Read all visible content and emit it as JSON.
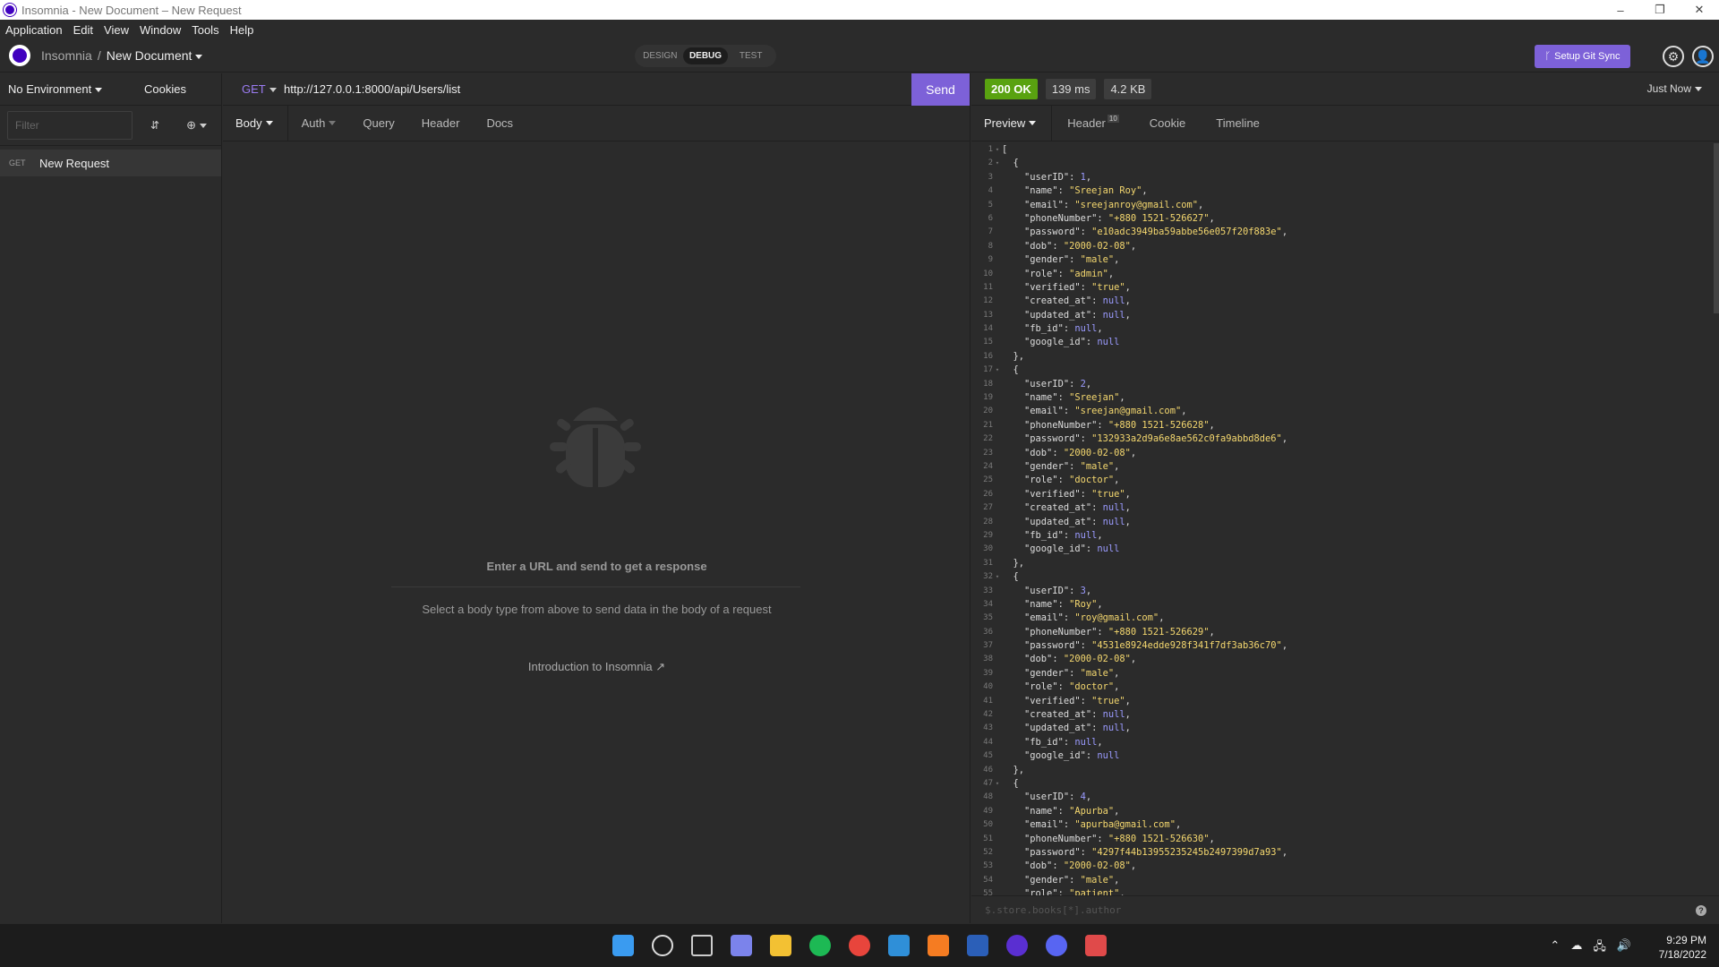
{
  "window": {
    "title": "Insomnia - New Document – New Request",
    "controls": [
      "–",
      "❐",
      "✕"
    ]
  },
  "menu": [
    "Application",
    "Edit",
    "View",
    "Window",
    "Tools",
    "Help"
  ],
  "header": {
    "app_name": "Insomnia",
    "separator": "/",
    "document": "New Document",
    "modes": [
      "DESIGN",
      "DEBUG",
      "TEST"
    ],
    "active_mode": "DEBUG",
    "git_sync_label": "Setup Git Sync"
  },
  "sidebar": {
    "environment": "No Environment",
    "cookies": "Cookies",
    "filter_placeholder": "Filter",
    "requests": [
      {
        "method": "GET",
        "name": "New Request"
      }
    ]
  },
  "request": {
    "method": "GET",
    "url": "http://127.0.0.1:8000/api/Users/list",
    "send_label": "Send",
    "tabs": [
      "Body",
      "Auth",
      "Query",
      "Header",
      "Docs"
    ],
    "empty_title": "Enter a URL and send to get a response",
    "empty_subtitle": "Select a body type from above to send data in the body of a request",
    "intro_link": "Introduction to Insomnia"
  },
  "response": {
    "status": "200 OK",
    "time": "139 ms",
    "size": "4.2 KB",
    "timestamp": "Just Now",
    "tabs": [
      "Preview",
      "Header",
      "Cookie",
      "Timeline"
    ],
    "header_count": "10",
    "filter_placeholder": "$.store.books[*].author",
    "help": "?",
    "users": [
      {
        "userID": 1,
        "name": "Sreejan Roy",
        "email": "sreejanroy@gmail.com",
        "phoneNumber": "+880 1521-526627",
        "password": "e10adc3949ba59abbe56e057f20f883e",
        "dob": "2000-02-08",
        "gender": "male",
        "role": "admin",
        "verified": "true"
      },
      {
        "userID": 2,
        "name": "Sreejan",
        "email": "sreejan@gmail.com",
        "phoneNumber": "+880 1521-526628",
        "password": "132933a2d9a6e8ae562c0fa9abbd8de6",
        "dob": "2000-02-08",
        "gender": "male",
        "role": "doctor",
        "verified": "true"
      },
      {
        "userID": 3,
        "name": "Roy",
        "email": "roy@gmail.com",
        "phoneNumber": "+880 1521-526629",
        "password": "4531e8924edde928f341f7df3ab36c70",
        "dob": "2000-02-08",
        "gender": "male",
        "role": "doctor",
        "verified": "true"
      },
      {
        "userID": 4,
        "name": "Apurba",
        "email": "apurba@gmail.com",
        "phoneNumber": "+880 1521-526630",
        "password": "4297f44b13955235245b2497399d7a93",
        "dob": "2000-02-08",
        "gender": "male",
        "role": "patient",
        "verified": null
      }
    ]
  },
  "taskbar": {
    "time": "9:29 PM",
    "date": "7/18/2022",
    "apps": [
      {
        "name": "start",
        "color": "#3a9bf0"
      },
      {
        "name": "search",
        "color": "#dddddd"
      },
      {
        "name": "task-view",
        "color": "#cccccc"
      },
      {
        "name": "teams-chat",
        "color": "#7b83eb"
      },
      {
        "name": "file-explorer",
        "color": "#f3c133"
      },
      {
        "name": "spotify",
        "color": "#1db954"
      },
      {
        "name": "chrome",
        "color": "#e8453c"
      },
      {
        "name": "vscode",
        "color": "#2f8fd8"
      },
      {
        "name": "xampp",
        "color": "#f57c22"
      },
      {
        "name": "word",
        "color": "#2b5fb8"
      },
      {
        "name": "insomnia",
        "color": "#5a2fd1"
      },
      {
        "name": "discord",
        "color": "#5865f2"
      },
      {
        "name": "snipping-tool",
        "color": "#e04a4a"
      }
    ]
  }
}
